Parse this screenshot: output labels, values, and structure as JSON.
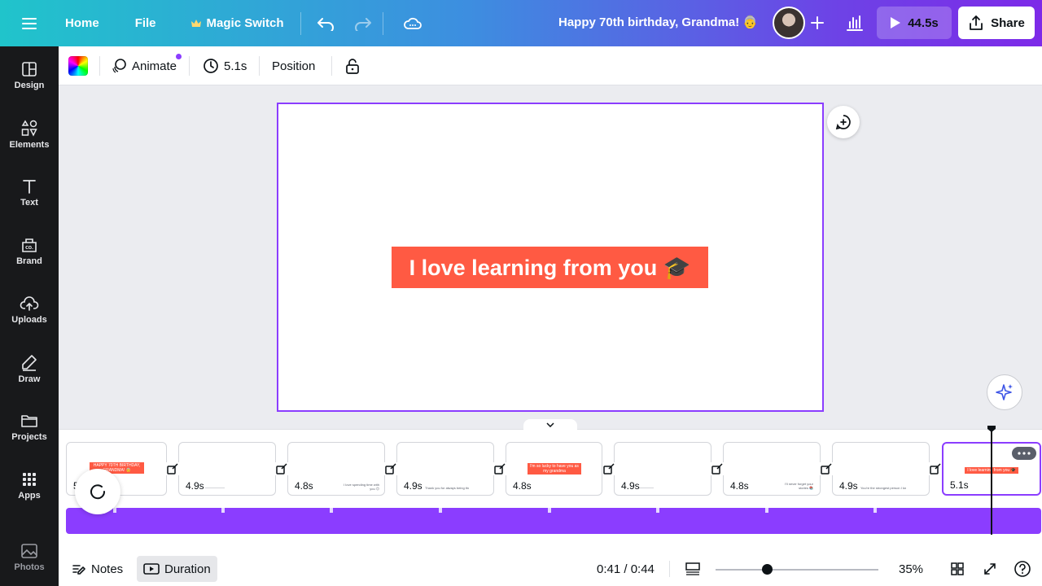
{
  "topbar": {
    "home_label": "Home",
    "file_label": "File",
    "magic_switch_label": "Magic Switch",
    "doc_title": "Happy 70th birthday, Grandma! 👵",
    "play_label": "44.5s",
    "share_label": "Share"
  },
  "sidebar": {
    "items": [
      {
        "label": "Design",
        "icon": "layout-icon"
      },
      {
        "label": "Elements",
        "icon": "shapes-icon"
      },
      {
        "label": "Text",
        "icon": "text-icon"
      },
      {
        "label": "Brand",
        "icon": "brand-icon"
      },
      {
        "label": "Uploads",
        "icon": "cloud-upload-icon"
      },
      {
        "label": "Draw",
        "icon": "pen-icon"
      },
      {
        "label": "Projects",
        "icon": "folder-icon"
      },
      {
        "label": "Apps",
        "icon": "grid-icon"
      },
      {
        "label": "Photos",
        "icon": "image-icon"
      }
    ]
  },
  "ctxbar": {
    "animate_label": "Animate",
    "duration_label": "5.1s",
    "position_label": "Position"
  },
  "canvas": {
    "slide_text": "I love learning from you 🎓"
  },
  "timeline": {
    "thumbs": [
      {
        "duration": "5",
        "tag": "HAPPY 70TH BIRTHDAY, GRANDMA! 👵"
      },
      {
        "duration": "4.9s"
      },
      {
        "duration": "4.8s",
        "mini": "I love spending time with you 😊"
      },
      {
        "duration": "4.9s",
        "mini": "Thank you for always being there for me 🤗"
      },
      {
        "duration": "4.8s",
        "tag": "I'm so lucky to have you as my grandma"
      },
      {
        "duration": "4.9s"
      },
      {
        "duration": "4.8s",
        "mini": "I'll never forget your stories 📚"
      },
      {
        "duration": "4.9s",
        "mini": "You're the strongest person I know 💪"
      },
      {
        "duration": "5.1s",
        "tag": "I love learning from you 🎓"
      }
    ]
  },
  "bottombar": {
    "notes_label": "Notes",
    "duration_label": "Duration",
    "time_readout": "0:41 / 0:44",
    "zoom_value": "35%"
  },
  "colors": {
    "accent": "#8b3dff",
    "slide_red": "#ff5a43",
    "sidebar_bg": "#18191b"
  }
}
